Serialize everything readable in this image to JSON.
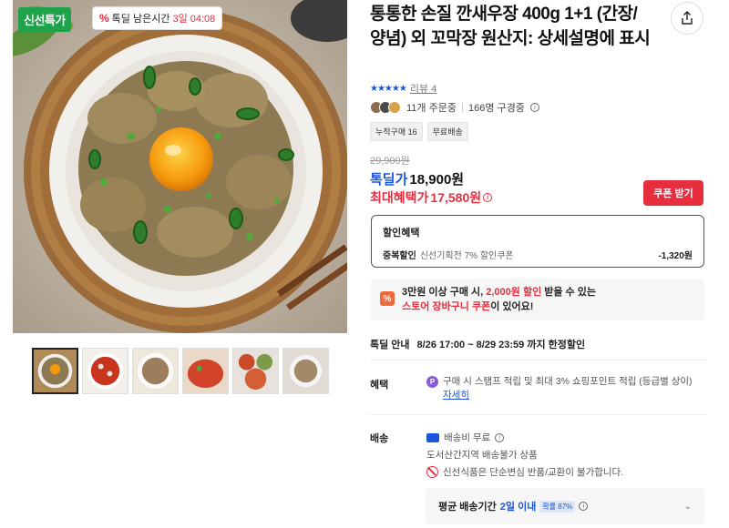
{
  "image": {
    "badge_label": "신선특가",
    "timer_prefix": "%",
    "timer_label": "톡딜 남은시간",
    "timer_value": "3일 04:08"
  },
  "thumbnails": [
    "양념 깐새우장 덮밥",
    "양념새우장 접시",
    "간장새우장 접시",
    "양념새우장 클로즈업",
    "새우장 상차림",
    "간장새우장 그릇"
  ],
  "product": {
    "title": "통통한 손질 깐새우장 400g 1+1 (간장/양념) 외 꼬막장 원산지: 상세설명에 표시",
    "rating_stars": "★★★★★",
    "review_label": "리뷰 4",
    "order_count": "11개 주문중",
    "subscribe_count": "166명 구경중",
    "tags": [
      "누적구매 16",
      "무료배송"
    ]
  },
  "price": {
    "original": "29,900원",
    "deal_label": "톡딜가",
    "deal_value": "18,900원",
    "max_label": "최대혜택가",
    "max_value": "17,580원",
    "coupon_button": "쿠폰 받기"
  },
  "discount": {
    "title": "할인혜택",
    "name": "중복할인",
    "desc": "신선기획전 7% 할인쿠폰",
    "amount": "-1,320원"
  },
  "promo": {
    "icon": "%",
    "line1_a": "3만원 이상 구매 시,",
    "line1_red": "2,000원 할인",
    "line1_b": "받을 수 있는",
    "line2_red": "스토어 장바구니 쿠폰",
    "line2_b": "이 있어요!"
  },
  "sale": {
    "label": "톡딜 안내",
    "value": "8/26 17:00 ~ 8/29 23:59 까지 한정할인"
  },
  "benefit": {
    "label": "혜택",
    "icon": "P",
    "text": "구매 시 스탬프 적립 및 최대 3% 쇼핑포인트 적립 (등급별 상이)",
    "link": "자세히"
  },
  "shipping": {
    "label": "배송",
    "fee": "배송비 무료",
    "restriction": "도서산간지역 배송불가 상품",
    "no_return": "신선식품은 단순변심 반품/교환이 불가합니다.",
    "avg_label": "평균 배송기간",
    "avg_value": "2일 이내",
    "avg_badge": "확률 87%"
  },
  "colors": {
    "accent_blue": "#1a56db",
    "accent_red": "#e62e3f",
    "badge_green": "#1ea34a"
  }
}
